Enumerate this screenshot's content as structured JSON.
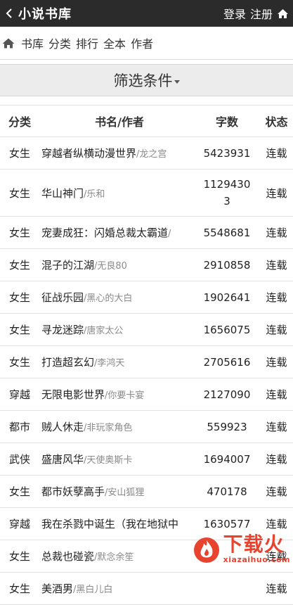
{
  "header": {
    "title": "小说书库",
    "login": "登录",
    "register": "注册"
  },
  "nav": {
    "items": [
      "书库",
      "分类",
      "排行",
      "全本",
      "作者"
    ]
  },
  "filter": {
    "label": "筛选条件"
  },
  "table": {
    "columns": [
      "分类",
      "书名/作者",
      "字数",
      "状态"
    ],
    "rows": [
      {
        "cat": "女生",
        "title": "穿越者纵横动漫世界",
        "author": "/龙之宫",
        "count": "5423931",
        "status": "连载"
      },
      {
        "cat": "女生",
        "title": "华山神门",
        "author": "/乐和",
        "count": "11294303",
        "status": "连载"
      },
      {
        "cat": "女生",
        "title": "宠妻成狂：闪婚总裁太霸道",
        "author": "/",
        "count": "5548681",
        "status": "连载"
      },
      {
        "cat": "女生",
        "title": "混子的江湖",
        "author": "/无良80",
        "count": "2910858",
        "status": "连载"
      },
      {
        "cat": "女生",
        "title": "征战乐园",
        "author": "/黑心的大白",
        "count": "1902641",
        "status": "连载"
      },
      {
        "cat": "女生",
        "title": "寻龙迷踪",
        "author": "/唐家太公",
        "count": "1656075",
        "status": "连载"
      },
      {
        "cat": "女生",
        "title": "打造超玄幻",
        "author": "/李鸿天",
        "count": "2705616",
        "status": "连载"
      },
      {
        "cat": "穿越",
        "title": "无限电影世界",
        "author": "/你要卡宴",
        "count": "2127090",
        "status": "连载"
      },
      {
        "cat": "都市",
        "title": "贼人休走",
        "author": "/非玩家角色",
        "count": "559923",
        "status": "连载"
      },
      {
        "cat": "武侠",
        "title": "盛唐风华",
        "author": "/天使奥斯卡",
        "count": "1694007",
        "status": "连载"
      },
      {
        "cat": "女生",
        "title": "都市妖孽高手",
        "author": "/安山狐狸",
        "count": "470178",
        "status": "连载"
      },
      {
        "cat": "穿越",
        "title": "我在杀戮中诞生（我在地狱中",
        "author": "",
        "count": "1630577",
        "status": "连载"
      },
      {
        "cat": "女生",
        "title": "总裁也碰瓷",
        "author": "/默念余笙",
        "count": "",
        "status": "连载"
      },
      {
        "cat": "女生",
        "title": "美酒男",
        "author": "/黑白儿白",
        "count": "",
        "status": "连载"
      }
    ]
  },
  "watermark": {
    "main": "下载火",
    "url": "xiazaihuo.com"
  },
  "colors": {
    "topbar": "#2b2b2b",
    "watermark": "#e8432f"
  }
}
